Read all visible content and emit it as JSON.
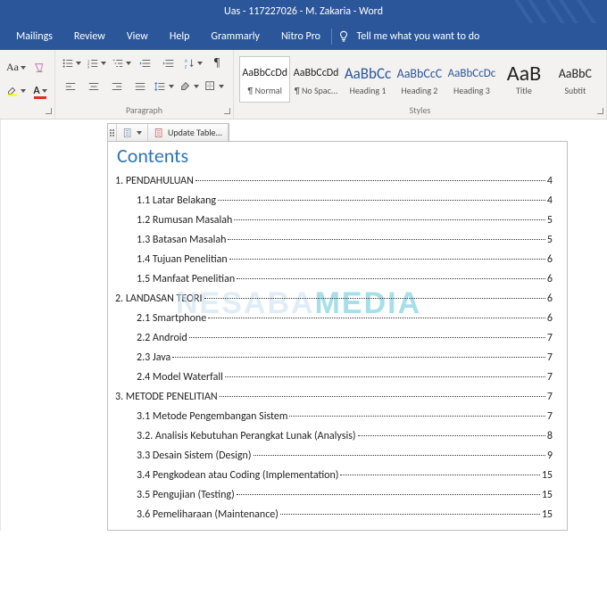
{
  "titlebar": {
    "title": "Uas - 117227026 - M. Zakaria  -  Word"
  },
  "ribbonTabs": {
    "items": [
      "Mailings",
      "Review",
      "View",
      "Help",
      "Grammarly",
      "Nitro Pro"
    ],
    "tellme": "Tell me what you want to do"
  },
  "ribbon": {
    "fontGroupLabel": "",
    "paragraphGroupLabel": "Paragraph",
    "stylesGroupLabel": "Styles",
    "styles": [
      {
        "sample": "AaBbCcDd",
        "name": "¶ Normal",
        "size": "12px",
        "blue": false
      },
      {
        "sample": "AaBbCcDd",
        "name": "¶ No Spac...",
        "size": "12px",
        "blue": false
      },
      {
        "sample": "AaBbCc",
        "name": "Heading 1",
        "size": "17px",
        "blue": true
      },
      {
        "sample": "AaBbCcC",
        "name": "Heading 2",
        "size": "14px",
        "blue": true
      },
      {
        "sample": "AaBbCcDc",
        "name": "Heading 3",
        "size": "13px",
        "blue": true
      },
      {
        "sample": "AaB",
        "name": "Title",
        "size": "24px",
        "blue": false
      },
      {
        "sample": "AaBbC",
        "name": "Subtit",
        "size": "14px",
        "blue": false
      }
    ]
  },
  "toc": {
    "updateLabel": "Update Table...",
    "title": "Contents",
    "entries": [
      {
        "level": 1,
        "text": "1. PENDAHULUAN",
        "page": "4"
      },
      {
        "level": 2,
        "text": "1.1 Latar Belakang",
        "page": "4"
      },
      {
        "level": 2,
        "text": "1.2 Rumusan Masalah",
        "page": "5"
      },
      {
        "level": 2,
        "text": "1.3 Batasan Masalah",
        "page": "5"
      },
      {
        "level": 2,
        "text": "1.4 Tujuan Penelitian",
        "page": "6"
      },
      {
        "level": 2,
        "text": "1.5 Manfaat Penelitian",
        "page": "6"
      },
      {
        "level": 1,
        "text": "2. LANDASAN TEORI",
        "page": "6"
      },
      {
        "level": 2,
        "text": "2.1 Smartphone",
        "page": "6"
      },
      {
        "level": 2,
        "text": "2.2 Android",
        "page": "7"
      },
      {
        "level": 2,
        "text": "2.3 Java",
        "page": "7"
      },
      {
        "level": 2,
        "text": "2.4 Model Waterfall",
        "page": "7"
      },
      {
        "level": 1,
        "text": "3. METODE PENELITIAN",
        "page": "7"
      },
      {
        "level": 2,
        "text": "3.1 Metode Pengembangan Sistem",
        "page": "7"
      },
      {
        "level": 2,
        "text": "3.2. Analisis Kebutuhan Perangkat Lunak (Analysis)",
        "page": "8"
      },
      {
        "level": 2,
        "text": "3.3 Desain Sistem (Design)",
        "page": "9"
      },
      {
        "level": 2,
        "text": "3.4 Pengkodean atau Coding (Implementation)",
        "page": "15"
      },
      {
        "level": 2,
        "text": "3.5 Pengujian (Testing)",
        "page": "15"
      },
      {
        "level": 2,
        "text": "3.6 Pemeliharaan (Maintenance)",
        "page": "15"
      }
    ]
  },
  "watermark": {
    "part1": "NESABA",
    "part2": "MEDIA"
  }
}
